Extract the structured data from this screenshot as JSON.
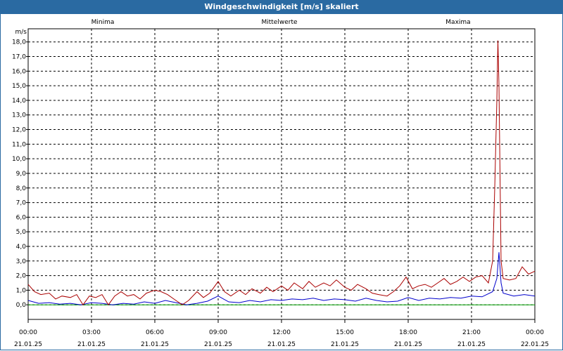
{
  "window": {
    "title": "Windgeschwindigkeit [m/s] skaliert"
  },
  "colors": {
    "titlebar": "#2a6aa2",
    "minima": "#00a000",
    "mittelwerte": "#0000cc",
    "maxima": "#aa0000",
    "grid": "#000000"
  },
  "chart_data": {
    "type": "line",
    "ylabel": "m/s",
    "ylim": [
      -1.0,
      18.9
    ],
    "yticks": [
      "0,0",
      "1,0",
      "2,0",
      "3,0",
      "4,0",
      "5,0",
      "6,0",
      "7,0",
      "8,0",
      "9,0",
      "10,0",
      "11,0",
      "12,0",
      "13,0",
      "14,0",
      "15,0",
      "16,0",
      "17,0",
      "18,0"
    ],
    "ytick_values": [
      0,
      1,
      2,
      3,
      4,
      5,
      6,
      7,
      8,
      9,
      10,
      11,
      12,
      13,
      14,
      15,
      16,
      17,
      18
    ],
    "xlim": [
      0,
      24
    ],
    "xticks": [
      {
        "hour": 0,
        "time": "00:00",
        "date": "21.01.25"
      },
      {
        "hour": 3,
        "time": "03:00",
        "date": "21.01.25"
      },
      {
        "hour": 6,
        "time": "06:00",
        "date": "21.01.25"
      },
      {
        "hour": 9,
        "time": "09:00",
        "date": "21.01.25"
      },
      {
        "hour": 12,
        "time": "12:00",
        "date": "21.01.25"
      },
      {
        "hour": 15,
        "time": "15:00",
        "date": "21.01.25"
      },
      {
        "hour": 18,
        "time": "18:00",
        "date": "21.01.25"
      },
      {
        "hour": 21,
        "time": "21:00",
        "date": "21.01.25"
      },
      {
        "hour": 24,
        "time": "00:00",
        "date": "22.01.25"
      }
    ],
    "grid": true,
    "legend_position": "top",
    "series": [
      {
        "name": "Minima",
        "color": "#00a000",
        "points": [
          [
            0,
            0.0
          ],
          [
            24,
            0.0
          ]
        ]
      },
      {
        "name": "Mittelwerte",
        "color": "#0000cc",
        "points": [
          [
            0,
            0.3
          ],
          [
            0.5,
            0.1
          ],
          [
            1,
            0.15
          ],
          [
            1.5,
            0.05
          ],
          [
            2,
            0.1
          ],
          [
            2.5,
            0.0
          ],
          [
            3,
            0.15
          ],
          [
            3.5,
            0.1
          ],
          [
            4,
            0.0
          ],
          [
            4.5,
            0.1
          ],
          [
            5,
            0.05
          ],
          [
            5.5,
            0.2
          ],
          [
            6,
            0.1
          ],
          [
            6.5,
            0.3
          ],
          [
            7,
            0.15
          ],
          [
            7.5,
            0.0
          ],
          [
            8,
            0.1
          ],
          [
            8.5,
            0.25
          ],
          [
            9,
            0.6
          ],
          [
            9.5,
            0.2
          ],
          [
            10,
            0.15
          ],
          [
            10.5,
            0.3
          ],
          [
            11,
            0.2
          ],
          [
            11.5,
            0.35
          ],
          [
            12,
            0.3
          ],
          [
            12.5,
            0.4
          ],
          [
            13,
            0.35
          ],
          [
            13.5,
            0.45
          ],
          [
            14,
            0.3
          ],
          [
            14.5,
            0.4
          ],
          [
            15,
            0.35
          ],
          [
            15.5,
            0.25
          ],
          [
            16,
            0.45
          ],
          [
            16.5,
            0.3
          ],
          [
            17,
            0.2
          ],
          [
            17.5,
            0.25
          ],
          [
            18,
            0.5
          ],
          [
            18.5,
            0.3
          ],
          [
            19,
            0.45
          ],
          [
            19.5,
            0.4
          ],
          [
            20,
            0.5
          ],
          [
            20.5,
            0.45
          ],
          [
            21,
            0.6
          ],
          [
            21.5,
            0.55
          ],
          [
            22,
            0.9
          ],
          [
            22.2,
            1.8
          ],
          [
            22.3,
            3.6
          ],
          [
            22.4,
            1.5
          ],
          [
            22.5,
            0.8
          ],
          [
            23,
            0.6
          ],
          [
            23.5,
            0.7
          ],
          [
            24,
            0.6
          ]
        ]
      },
      {
        "name": "Maxima",
        "color": "#aa0000",
        "points": [
          [
            0,
            1.4
          ],
          [
            0.3,
            0.9
          ],
          [
            0.6,
            0.7
          ],
          [
            1,
            0.8
          ],
          [
            1.3,
            0.4
          ],
          [
            1.6,
            0.6
          ],
          [
            2,
            0.5
          ],
          [
            2.3,
            0.7
          ],
          [
            2.6,
            0.0
          ],
          [
            2.9,
            0.6
          ],
          [
            3.2,
            0.5
          ],
          [
            3.5,
            0.7
          ],
          [
            3.8,
            0.0
          ],
          [
            4.1,
            0.6
          ],
          [
            4.4,
            0.9
          ],
          [
            4.7,
            0.6
          ],
          [
            5,
            0.7
          ],
          [
            5.3,
            0.4
          ],
          [
            5.6,
            0.8
          ],
          [
            6,
            1.0
          ],
          [
            6.3,
            0.9
          ],
          [
            6.6,
            0.7
          ],
          [
            7,
            0.3
          ],
          [
            7.3,
            0.0
          ],
          [
            7.6,
            0.3
          ],
          [
            8,
            0.9
          ],
          [
            8.3,
            0.5
          ],
          [
            8.6,
            0.8
          ],
          [
            9,
            1.6
          ],
          [
            9.3,
            0.9
          ],
          [
            9.6,
            0.6
          ],
          [
            10,
            1.0
          ],
          [
            10.3,
            0.7
          ],
          [
            10.6,
            1.1
          ],
          [
            11,
            0.8
          ],
          [
            11.3,
            1.2
          ],
          [
            11.6,
            0.9
          ],
          [
            12,
            1.3
          ],
          [
            12.3,
            1.0
          ],
          [
            12.6,
            1.5
          ],
          [
            13,
            1.1
          ],
          [
            13.3,
            1.6
          ],
          [
            13.6,
            1.2
          ],
          [
            14,
            1.5
          ],
          [
            14.3,
            1.3
          ],
          [
            14.6,
            1.7
          ],
          [
            15,
            1.2
          ],
          [
            15.3,
            1.0
          ],
          [
            15.6,
            1.4
          ],
          [
            16,
            1.1
          ],
          [
            16.3,
            0.8
          ],
          [
            16.6,
            0.7
          ],
          [
            17,
            0.6
          ],
          [
            17.3,
            0.9
          ],
          [
            17.6,
            1.3
          ],
          [
            17.9,
            1.9
          ],
          [
            18.2,
            1.1
          ],
          [
            18.5,
            1.3
          ],
          [
            18.8,
            1.4
          ],
          [
            19.1,
            1.2
          ],
          [
            19.4,
            1.5
          ],
          [
            19.7,
            1.8
          ],
          [
            20,
            1.4
          ],
          [
            20.3,
            1.6
          ],
          [
            20.6,
            1.9
          ],
          [
            20.9,
            1.6
          ],
          [
            21.2,
            1.9
          ],
          [
            21.5,
            2.0
          ],
          [
            21.8,
            1.5
          ],
          [
            22,
            3.0
          ],
          [
            22.1,
            8.0
          ],
          [
            22.2,
            14.0
          ],
          [
            22.25,
            18.1
          ],
          [
            22.3,
            15.0
          ],
          [
            22.35,
            9.0
          ],
          [
            22.4,
            3.0
          ],
          [
            22.5,
            1.8
          ],
          [
            22.8,
            1.7
          ],
          [
            23.1,
            1.8
          ],
          [
            23.4,
            2.6
          ],
          [
            23.7,
            2.1
          ],
          [
            24,
            2.3
          ]
        ]
      }
    ]
  }
}
